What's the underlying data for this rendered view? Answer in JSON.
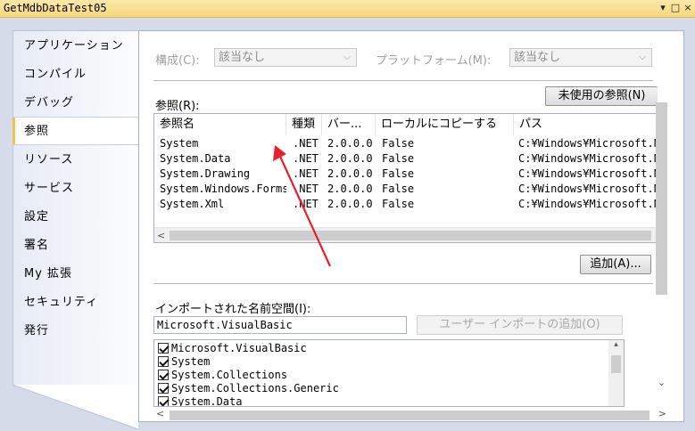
{
  "window": {
    "title": "GetMdbDataTest05",
    "controls": [
      "▾",
      "□",
      "×"
    ]
  },
  "nav": {
    "items": [
      {
        "label": "アプリケーション"
      },
      {
        "label": "コンパイル"
      },
      {
        "label": "デバッグ"
      },
      {
        "label": "参照",
        "active": true
      },
      {
        "label": "リソース"
      },
      {
        "label": "サービス"
      },
      {
        "label": "設定"
      },
      {
        "label": "署名"
      },
      {
        "label": "My 拡張"
      },
      {
        "label": "セキュリティ"
      },
      {
        "label": "発行"
      }
    ]
  },
  "config": {
    "config_label": "構成(C):",
    "config_value": "該当なし",
    "platform_label": "プラットフォーム(M):",
    "platform_value": "該当なし"
  },
  "references": {
    "label": "参照(R):",
    "unused_button": "未使用の参照(N)",
    "columns": [
      "参照名",
      "種類",
      "バー...",
      "ローカルにコピーする",
      "パス"
    ],
    "rows": [
      [
        "System",
        ".NET",
        "2.0.0.0",
        "False",
        "C:¥Windows¥Microsoft.N"
      ],
      [
        "System.Data",
        ".NET",
        "2.0.0.0",
        "False",
        "C:¥Windows¥Microsoft.N"
      ],
      [
        "System.Drawing",
        ".NET",
        "2.0.0.0",
        "False",
        "C:¥Windows¥Microsoft.N"
      ],
      [
        "System.Windows.Forms",
        ".NET",
        "2.0.0.0",
        "False",
        "C:¥Windows¥Microsoft.N"
      ],
      [
        "System.Xml",
        ".NET",
        "2.0.0.0",
        "False",
        "C:¥Windows¥Microsoft.N"
      ]
    ],
    "add_button": "追加(A)..."
  },
  "imports": {
    "label": "インポートされた名前空間(I):",
    "input_value": "Microsoft.VisualBasic",
    "add_user_button": "ユーザー インポートの追加(O)",
    "items": [
      {
        "label": "Microsoft.VisualBasic",
        "checked": true
      },
      {
        "label": "System",
        "checked": true
      },
      {
        "label": "System.Collections",
        "checked": true
      },
      {
        "label": "System.Collections.Generic",
        "checked": true
      },
      {
        "label": "System.Data",
        "checked": true
      }
    ]
  },
  "colors": {
    "annotation_arrow": "#e8202a",
    "title_bar": "#f6d77e",
    "active_tab_accent": "#f1c34a"
  }
}
